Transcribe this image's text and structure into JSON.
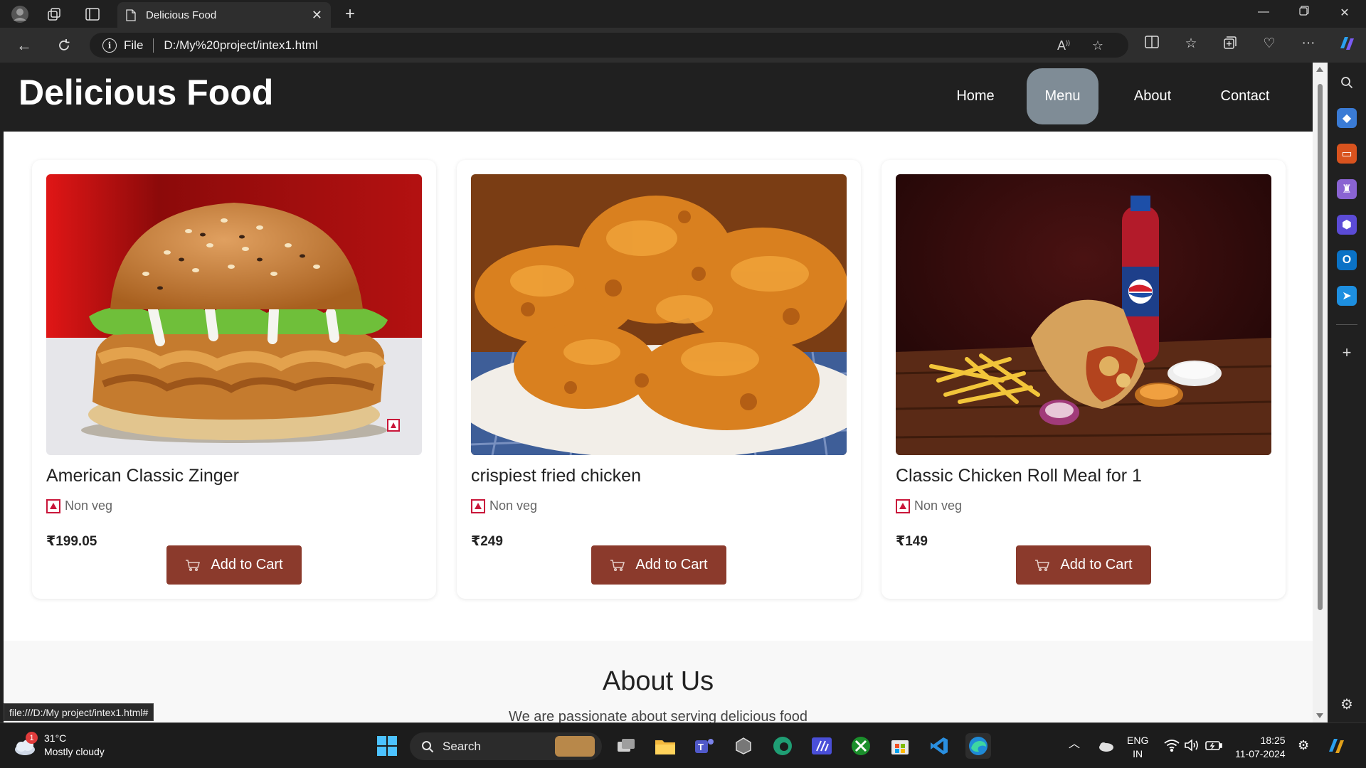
{
  "browser": {
    "tab_title": "Delicious Food",
    "omnibox_file_label": "File",
    "url": "D:/My%20project/intex1.html",
    "status_url": "file:///D:/My project/intex1.html#"
  },
  "site": {
    "logo": "Delicious Food",
    "nav": [
      {
        "label": "Home",
        "active": false
      },
      {
        "label": "Menu",
        "active": true
      },
      {
        "label": "About",
        "active": false
      },
      {
        "label": "Contact",
        "active": false
      }
    ],
    "products": [
      {
        "name": "American Classic Zinger",
        "tag": "Non veg",
        "price": "₹199.05",
        "button": "Add to Cart",
        "image": "burger"
      },
      {
        "name": "crispiest fried chicken",
        "tag": "Non veg",
        "price": "₹249",
        "button": "Add to Cart",
        "image": "fried-chicken"
      },
      {
        "name": "Classic Chicken Roll Meal for 1",
        "tag": "Non veg",
        "price": "₹149",
        "button": "Add to Cart",
        "image": "roll-meal"
      }
    ],
    "about": {
      "title": "About Us",
      "text": "We are passionate about serving delicious food"
    },
    "colors": {
      "header_bg": "#202020",
      "nav_active": "#7f8c96",
      "button_bg": "#8b3a2c",
      "nonveg_mark": "#c9163a"
    }
  },
  "taskbar": {
    "weather_temp": "31°C",
    "weather_desc": "Mostly cloudy",
    "weather_badge": "1",
    "search_label": "Search",
    "lang_top": "ENG",
    "lang_bottom": "IN",
    "time": "18:25",
    "date": "11-07-2024"
  }
}
